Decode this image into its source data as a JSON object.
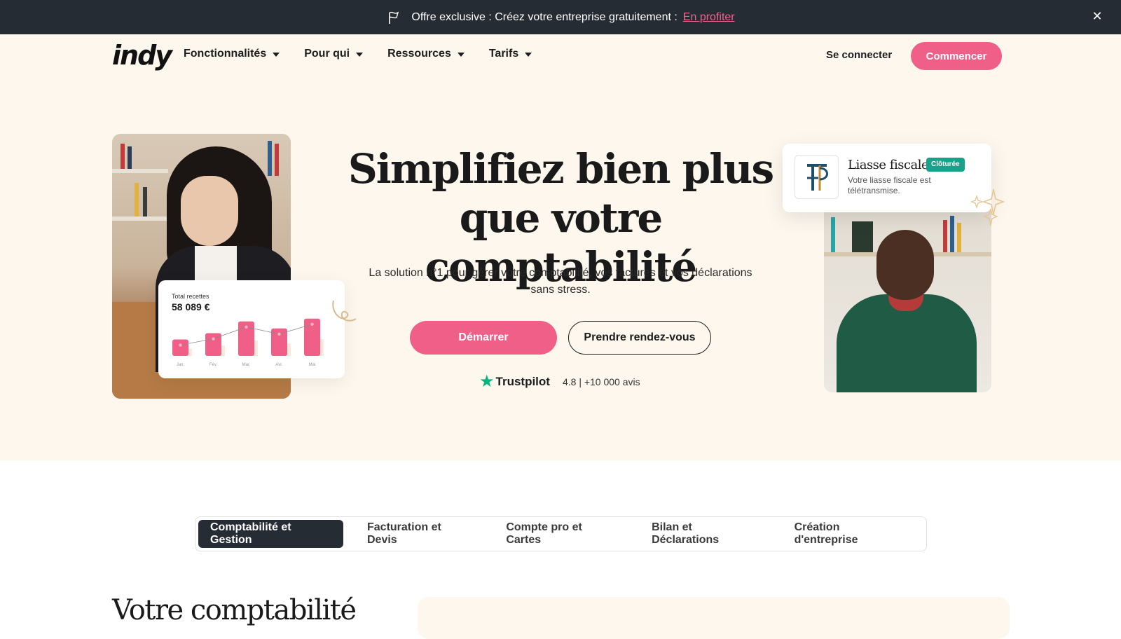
{
  "banner": {
    "text": "Offre exclusive : Créez votre entreprise gratuitement :",
    "link": "En profiter",
    "close_icon": "close-icon",
    "flag_icon": "flag-icon"
  },
  "nav": {
    "logo": "indy",
    "menu": [
      {
        "label": "Fonctionnalités"
      },
      {
        "label": "Pour qui"
      },
      {
        "label": "Ressources"
      },
      {
        "label": "Tarifs"
      }
    ],
    "login": "Se connecter",
    "cta": "Commencer"
  },
  "hero": {
    "title_line1": "Simplifiez bien plus",
    "title_line2": "que votre comptabilité",
    "subtitle": "La solution n°1 pour gérer votre comptabilité, vos factures et vos déclarations sans stress.",
    "primary_button": "Démarrer",
    "secondary_button": "Prendre rendez-vous",
    "trustpilot": {
      "brand": "Trustpilot",
      "rating": "4.8 | +10 000 avis"
    }
  },
  "stats_card": {
    "label": "Total recettes",
    "amount": "58 089 €",
    "chart_data": {
      "type": "bar",
      "categories": [
        "Jan.",
        "Fév.",
        "Mar.",
        "Avr.",
        "Mai"
      ],
      "values": [
        0.42,
        0.58,
        0.88,
        0.7,
        0.95
      ],
      "accent": "#ef5f87",
      "ghost": "#fde8dc"
    }
  },
  "liasse_card": {
    "title": "Liasse fiscale",
    "badge": "Clôturée",
    "text": "Votre liasse fiscale est télétransmise."
  },
  "tabs": [
    {
      "label": "Comptabilité et Gestion",
      "active": true
    },
    {
      "label": "Facturation et Devis",
      "active": false
    },
    {
      "label": "Compte pro et Cartes",
      "active": false
    },
    {
      "label": "Bilan et Déclarations",
      "active": false
    },
    {
      "label": "Création d'entreprise",
      "active": false
    }
  ],
  "section": {
    "title": "Votre comptabilité"
  },
  "colors": {
    "accent": "#ef5f87",
    "dark": "#252c33",
    "cream": "#fdf7ee",
    "badge": "#17a38a"
  }
}
